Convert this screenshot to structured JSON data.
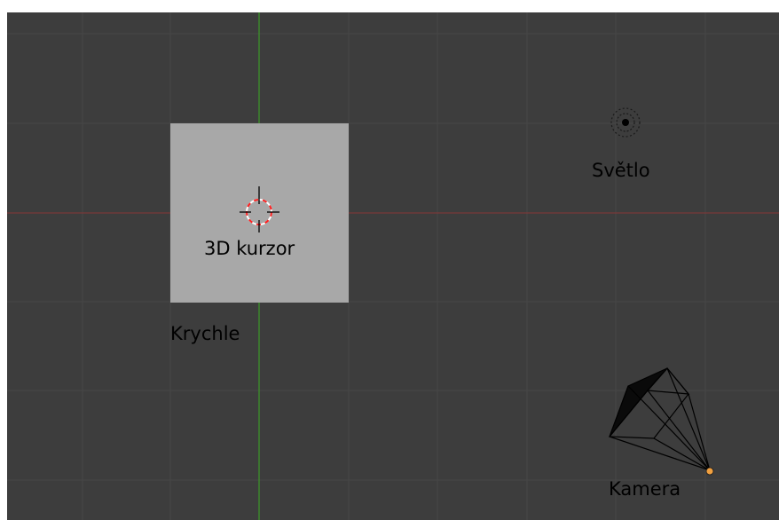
{
  "viewport": {
    "background": "#3d3d3d",
    "grid_line_color": "#474747",
    "x_axis_color": "#7a3a3a",
    "y_axis_color": "#3c8c2c"
  },
  "objects": {
    "cube": {
      "label": "Krychle",
      "color": "#a8a8a8"
    },
    "cursor": {
      "label": "3D kurzor",
      "icon": "crosshair-icon",
      "ring_colors": [
        "#ff2020",
        "#ffffff"
      ]
    },
    "light": {
      "label": "Světlo",
      "icon": "lamp-icon"
    },
    "camera": {
      "label": "Kamera",
      "icon": "camera-icon",
      "origin_color": "#f0a040"
    }
  }
}
